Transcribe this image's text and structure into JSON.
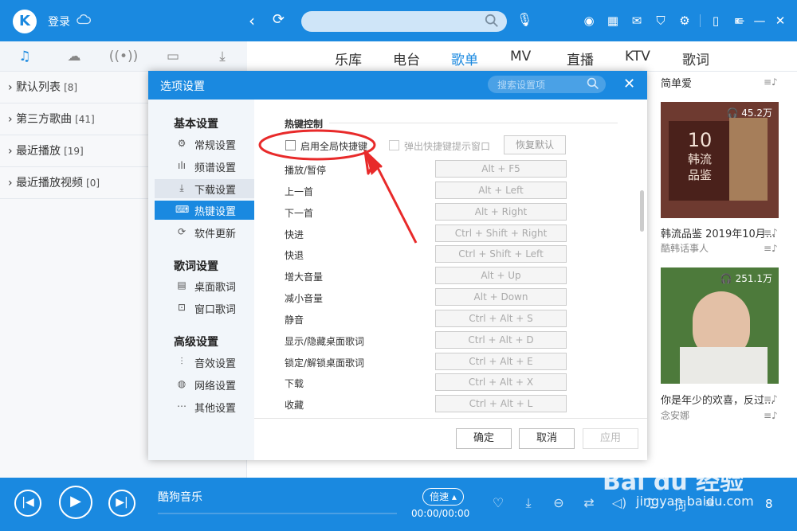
{
  "top": {
    "logo": "K",
    "login": "登录",
    "icons": [
      "skin-icon",
      "mini-mode-icon",
      "mail-icon",
      "shirt-icon",
      "gear-icon",
      "phone-icon",
      "exit-icon"
    ]
  },
  "sidetabs": [
    "♫",
    "☁",
    "((•))",
    "▭",
    "⤓"
  ],
  "nav": {
    "tabs": [
      "乐库",
      "电台",
      "歌单",
      "MV",
      "直播",
      "KTV",
      "歌词"
    ],
    "active": "歌单"
  },
  "sidebar": {
    "items": [
      {
        "label": "默认列表",
        "count": "[8]"
      },
      {
        "label": "第三方歌曲",
        "count": "[41]"
      },
      {
        "label": "最近播放",
        "count": "[19]"
      },
      {
        "label": "最近播放视频",
        "count": "[0]"
      }
    ]
  },
  "right": {
    "top_text": "简单爱",
    "album1": {
      "count": "45.2万",
      "num": "10",
      "line1": "韩流",
      "line2": "品鉴",
      "title": "韩流品鉴 2019年10月...",
      "author": "酷韩话事人"
    },
    "album2": {
      "count": "251.1万",
      "title": "你是年少的欢喜，反过...",
      "author": "念安娜"
    }
  },
  "player": {
    "song": "酷狗音乐",
    "speed": "倍速",
    "time": "00:00/00:00",
    "count": "8"
  },
  "dialog": {
    "title": "选项设置",
    "search_placeholder": "搜索设置项",
    "sections": [
      {
        "title": "基本设置",
        "items": [
          {
            "label": "常规设置",
            "icon": "⚙"
          },
          {
            "label": "频谱设置",
            "icon": "ılı"
          },
          {
            "label": "下载设置",
            "icon": "⤓"
          },
          {
            "label": "热键设置",
            "icon": "⌨"
          },
          {
            "label": "软件更新",
            "icon": "⟳"
          }
        ]
      },
      {
        "title": "歌词设置",
        "items": [
          {
            "label": "桌面歌词",
            "icon": "▤"
          },
          {
            "label": "窗口歌词",
            "icon": "⊡"
          }
        ]
      },
      {
        "title": "高级设置",
        "items": [
          {
            "label": "音效设置",
            "icon": "⫶"
          },
          {
            "label": "网络设置",
            "icon": "◍"
          },
          {
            "label": "其他设置",
            "icon": "⋯"
          }
        ]
      }
    ],
    "hotkey": {
      "section_title": "热键控制",
      "enable_global": "启用全局快捷键",
      "show_tip": "弹出快捷键提示窗口",
      "restore": "恢复默认",
      "rows": [
        {
          "name": "播放/暂停",
          "key": "Alt + F5"
        },
        {
          "name": "上一首",
          "key": "Alt + Left"
        },
        {
          "name": "下一首",
          "key": "Alt + Right"
        },
        {
          "name": "快进",
          "key": "Ctrl + Shift + Right"
        },
        {
          "name": "快退",
          "key": "Ctrl + Shift + Left"
        },
        {
          "name": "增大音量",
          "key": "Alt + Up"
        },
        {
          "name": "减小音量",
          "key": "Alt + Down"
        },
        {
          "name": "静音",
          "key": "Ctrl + Alt + S"
        },
        {
          "name": "显示/隐藏桌面歌词",
          "key": "Ctrl + Alt + D"
        },
        {
          "name": "锁定/解锁桌面歌词",
          "key": "Ctrl + Alt + E"
        },
        {
          "name": "下载",
          "key": "Ctrl + Alt + X"
        },
        {
          "name": "收藏",
          "key": "Ctrl + Alt + L"
        }
      ]
    },
    "buttons": {
      "ok": "确定",
      "cancel": "取消",
      "apply": "应用"
    }
  },
  "watermark": {
    "main": "Bai du 经验",
    "sub": "jingyan.baidu.com"
  }
}
